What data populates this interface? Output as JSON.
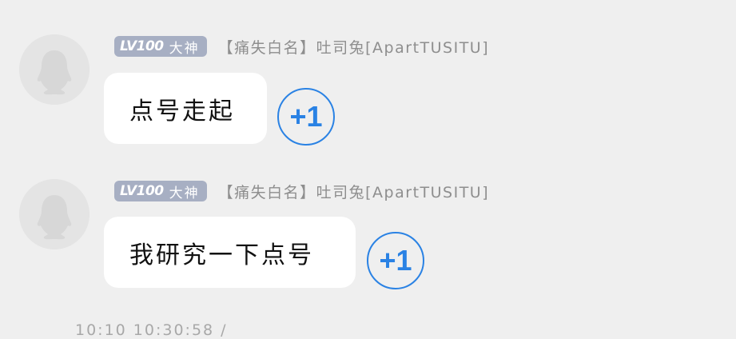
{
  "messages": [
    {
      "badge": {
        "level": "LV100",
        "title": "大神"
      },
      "nickname": "【痛失白名】吐司兔[ApartTUSITU]",
      "text": "点号走起",
      "reaction": "+1",
      "avatar_icon": "default-avatar-icon"
    },
    {
      "badge": {
        "level": "LV100",
        "title": "大神"
      },
      "nickname": "【痛失白名】吐司兔[ApartTUSITU]",
      "text": "我研究一下点号",
      "reaction": "+1",
      "avatar_icon": "default-avatar-icon"
    }
  ],
  "timestamp": "10:10 10:30:58 /",
  "colors": {
    "background": "#efefef",
    "bubble": "#ffffff",
    "badge": "#a7afc3",
    "reaction": "#2a82e4",
    "nickname": "#8e8e8e"
  }
}
